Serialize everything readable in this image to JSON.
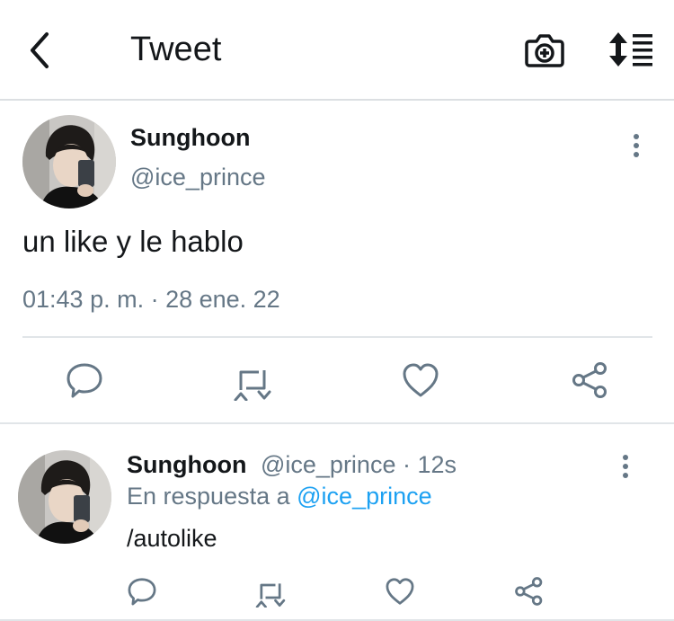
{
  "header": {
    "title": "Tweet",
    "back_icon": "chevron-left-icon",
    "camera_icon": "camera-add-icon",
    "sort_icon": "sort-lines-icon"
  },
  "main_tweet": {
    "display_name": "Sunghoon",
    "handle": "@ice_prince",
    "text": "un like y le hablo",
    "timestamp": "01:43 p. m. · 28 ene. 22",
    "actions": [
      "reply-icon",
      "retweet-icon",
      "like-icon",
      "share-icon"
    ]
  },
  "reply_tweet": {
    "display_name": "Sunghoon",
    "handle_time": "@ice_prince · 12s",
    "reply_prefix": "En respuesta a",
    "reply_to": "@ice_prince",
    "text": "/autolike",
    "actions": [
      "reply-icon",
      "retweet-icon",
      "like-icon",
      "share-icon"
    ]
  },
  "colors": {
    "text": "#14171a",
    "secondary": "#657786",
    "link": "#1da1f2",
    "divider": "#e1e5e8",
    "icon": "#657786"
  }
}
